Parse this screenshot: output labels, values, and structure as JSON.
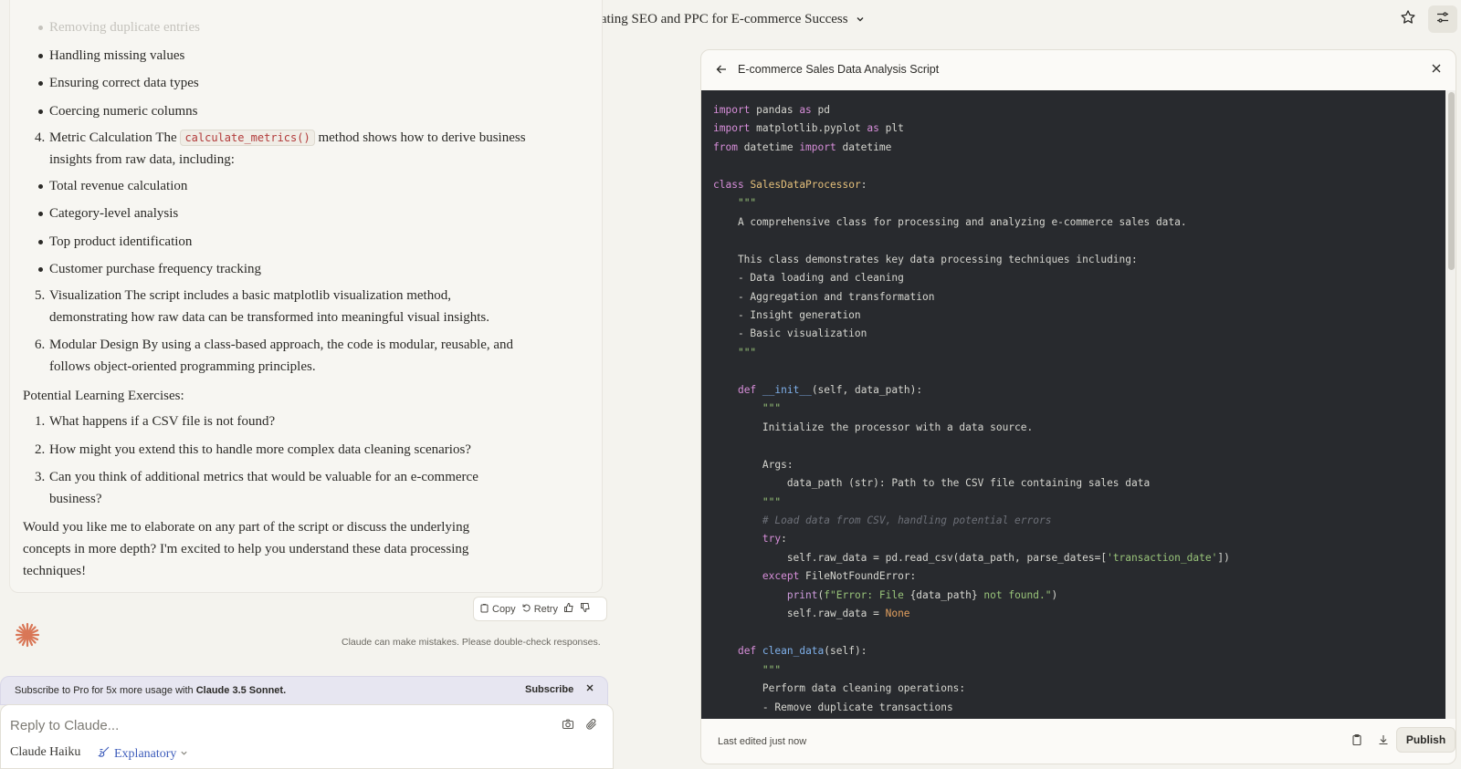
{
  "header": {
    "title": "Integrating SEO and PPC for E-commerce Success"
  },
  "chat": {
    "lines": [
      "Removing duplicate entries",
      "Handling missing values",
      "Ensuring correct data types",
      "Coercing numeric columns",
      "Metric Calculation The",
      "calculate_metrics()",
      "method shows how to derive business",
      "insights from raw data, including:",
      "Total revenue calculation",
      "Category-level analysis",
      "Top product identification",
      "Customer purchase frequency tracking",
      "Visualization The script includes a basic matplotlib visualization method,",
      "demonstrating how raw data can be transformed into meaningful visual insights.",
      "Modular Design By using a class-based approach, the code is modular, reusable, and",
      "follows object-oriented programming principles.",
      "Potential Learning Exercises:",
      "What happens if a CSV file is not found?",
      "How might you extend this to handle more complex data cleaning scenarios?",
      "Can you think of additional metrics that would be valuable for an e-commerce",
      "business?",
      "Would you like me to elaborate on any part of the script or discuss the underlying",
      "concepts in more depth? I'm excited to help you understand these data processing",
      "techniques!"
    ],
    "numbers": [
      "4.",
      "5.",
      "6.",
      "1.",
      "2.",
      "3."
    ],
    "actions": {
      "copy": "Copy",
      "retry": "Retry"
    },
    "disclaimer": "Claude can make mistakes. Please double-check responses."
  },
  "subscribe": {
    "msg_prefix": "Subscribe to Pro for 5x more usage with",
    "msg_bold": "Claude 3.5 Sonnet.",
    "button": "Subscribe"
  },
  "composer": {
    "placeholder": "Reply to Claude...",
    "model": "Claude Haiku",
    "style": "Explanatory"
  },
  "artifact": {
    "title": "E-commerce Sales Data Analysis Script",
    "last_edited": "Last edited just now",
    "publish": "Publish"
  },
  "colors": {
    "page_bg": "#f4f3ee",
    "code_bg": "#282a2e",
    "accent_orange": "#d97757",
    "style_blue": "#3e5dbb"
  },
  "icons": {
    "header": [
      "chat-icon",
      "chevron-down-icon",
      "star-icon",
      "sliders-icon"
    ],
    "artifact": [
      "back-arrow-icon",
      "close-icon",
      "copy-icon",
      "download-icon"
    ],
    "composer": [
      "camera-icon",
      "paperclip-icon",
      "brush-icon"
    ]
  }
}
